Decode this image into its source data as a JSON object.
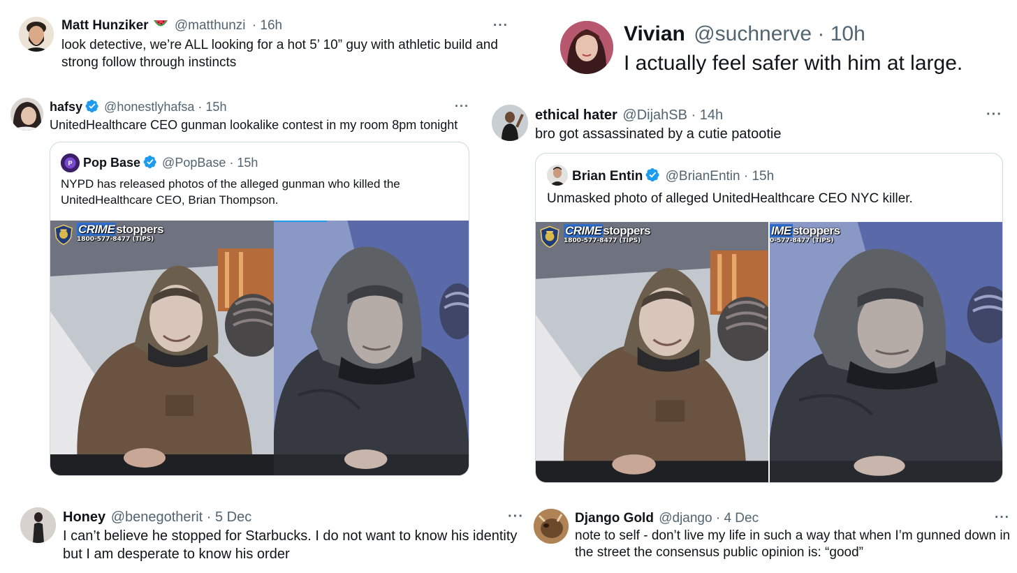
{
  "colors": {
    "verified_blue": "#1d9bf0",
    "text": "#0f1419",
    "secondary": "#536471",
    "border": "#cfd9de",
    "crimestoppers_blue": "#2e6fd0"
  },
  "tweets": {
    "matt": {
      "name": "Matt Hunziker",
      "emoji": "watermelon-icon",
      "handle": "@matthunzi",
      "time": "· 16h",
      "text": "look detective, we’re ALL looking for a hot 5’ 10” guy with athletic build and strong follow through instincts"
    },
    "vivian": {
      "name": "Vivian",
      "handle": "@suchnerve",
      "time": "· 10h",
      "text": "I actually feel safer with him at large."
    },
    "hafsy": {
      "name": "hafsy",
      "handle": "@honestlyhafsa",
      "time": "· 15h",
      "text": "UnitedHealthcare CEO gunman lookalike contest in my room 8pm tonight",
      "quote": {
        "name": "Pop Base",
        "handle": "@PopBase",
        "time": "· 15h",
        "text": "NYPD has released photos of the alleged gunman who killed the UnitedHealthcare CEO, Brian Thompson."
      }
    },
    "ethical": {
      "name": "ethical hater",
      "handle": "@DijahSB",
      "time": "· 14h",
      "text": "bro got assassinated by a cutie patootie",
      "quote": {
        "name": "Brian Entin",
        "handle": "@BrianEntin",
        "time": "· 15h",
        "text": "Unmasked photo of alleged UnitedHealthcare CEO NYC killer."
      }
    },
    "honey": {
      "name": "Honey",
      "handle": "@benegotherit",
      "time": "· 5 Dec",
      "text": "I can’t believe he stopped for Starbucks. I do not want to know his identity but I am desperate to know his order"
    },
    "django": {
      "name": "Django Gold",
      "handle": "@django",
      "time": "· 4 Dec",
      "text": "note to self - don’t live my life in such a way that when I’m gunned down in the street the consensus public opinion is: “good”"
    }
  },
  "more_label": "···",
  "crimestoppers": {
    "title_box": "CRIME",
    "title_rest": "stoppers",
    "phone": "1800-577-8477 (TIPS)",
    "nypd": "NYPD",
    "title_box_cropped": "IME",
    "phone_cropped": "0-577-8477 (TIPS)"
  }
}
